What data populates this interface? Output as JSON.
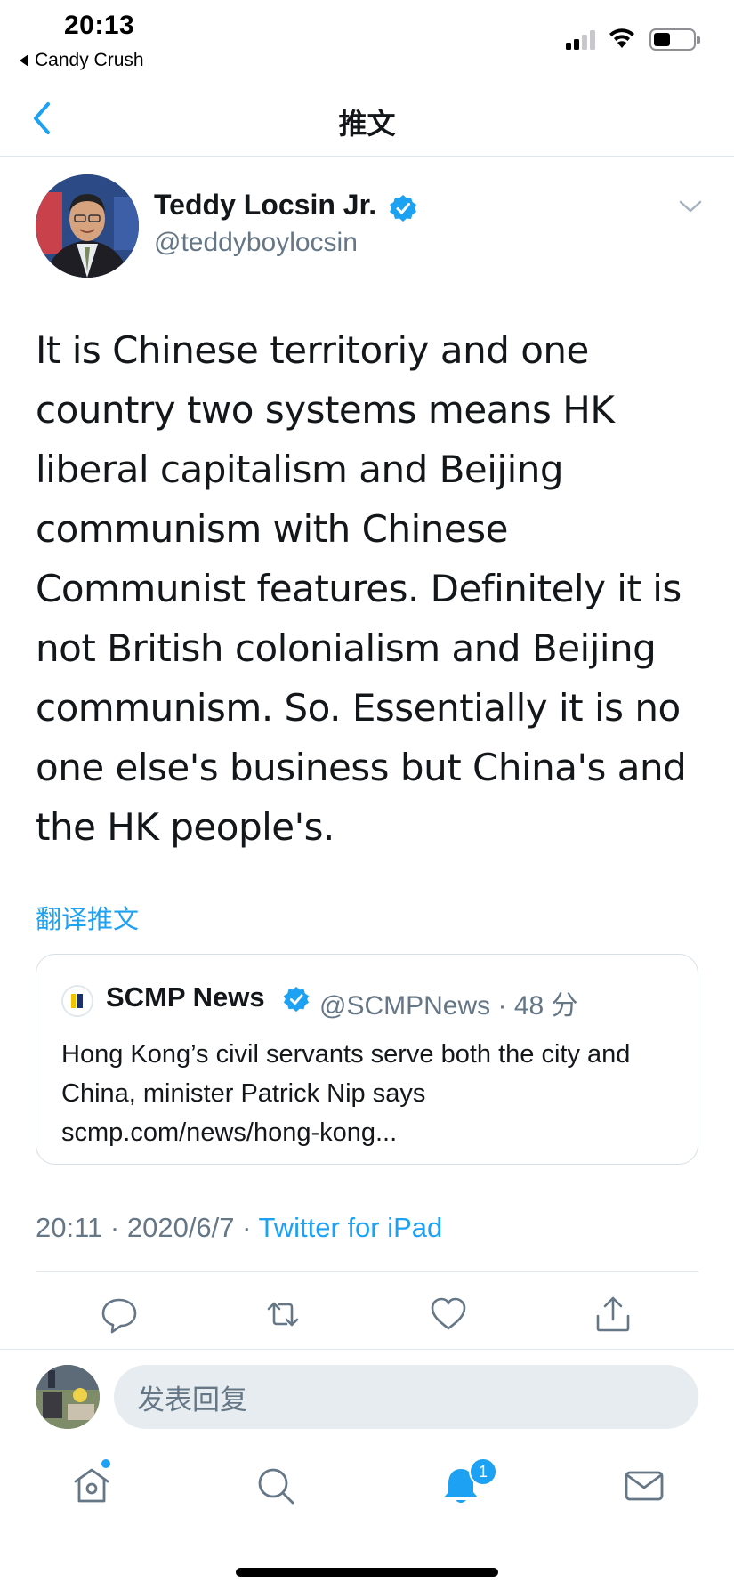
{
  "status_bar": {
    "time": "20:13",
    "back_app": "Candy Crush"
  },
  "nav": {
    "title": "推文",
    "back_icon": "chevron-left-icon"
  },
  "tweet": {
    "author_name": "Teddy Locsin Jr.",
    "author_handle": "@teddyboylocsin",
    "text": "It is Chinese territoriy and one country two systems means HK liberal capitalism and Beijing communism with Chinese Communist features. Definitely it is not British colonialism and Beijing communism. So. Essentially it is no one else's business but China's and the HK people's.",
    "translate_label": "翻译推文",
    "time": "20:11",
    "date": "2020/6/7",
    "separator": "·",
    "source": "Twitter for iPad"
  },
  "quote": {
    "name": "SCMP News",
    "handle": "@SCMPNews",
    "separator": "·",
    "age": "48 分",
    "text": "Hong Kong’s civil servants serve both the city and China, minister Patrick Nip says scmp.com/news/hong-kong..."
  },
  "actions": [
    "reply-icon",
    "retweet-icon",
    "like-icon",
    "share-icon"
  ],
  "reply": {
    "placeholder": "发表回复"
  },
  "tab_bar": {
    "tabs": [
      "home-icon",
      "search-icon",
      "notifications-icon",
      "messages-icon"
    ],
    "notifications_badge": "1"
  },
  "colors": {
    "accent": "#1da1f2",
    "secondary_text": "#657786",
    "primary_text": "#14171a",
    "divider": "#e1e8ed",
    "input_bg": "#e6ecf0"
  }
}
